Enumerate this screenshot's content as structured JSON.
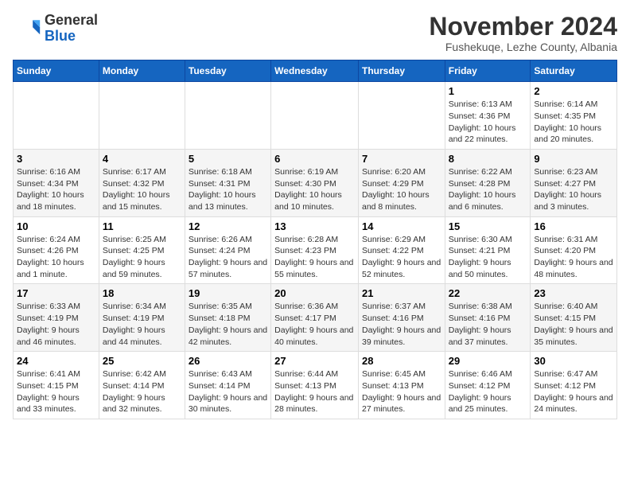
{
  "logo": {
    "general": "General",
    "blue": "Blue"
  },
  "title": "November 2024",
  "subtitle": "Fushekuqe, Lezhe County, Albania",
  "days_of_week": [
    "Sunday",
    "Monday",
    "Tuesday",
    "Wednesday",
    "Thursday",
    "Friday",
    "Saturday"
  ],
  "weeks": [
    [
      {
        "day": "",
        "info": ""
      },
      {
        "day": "",
        "info": ""
      },
      {
        "day": "",
        "info": ""
      },
      {
        "day": "",
        "info": ""
      },
      {
        "day": "",
        "info": ""
      },
      {
        "day": "1",
        "info": "Sunrise: 6:13 AM\nSunset: 4:36 PM\nDaylight: 10 hours and 22 minutes."
      },
      {
        "day": "2",
        "info": "Sunrise: 6:14 AM\nSunset: 4:35 PM\nDaylight: 10 hours and 20 minutes."
      }
    ],
    [
      {
        "day": "3",
        "info": "Sunrise: 6:16 AM\nSunset: 4:34 PM\nDaylight: 10 hours and 18 minutes."
      },
      {
        "day": "4",
        "info": "Sunrise: 6:17 AM\nSunset: 4:32 PM\nDaylight: 10 hours and 15 minutes."
      },
      {
        "day": "5",
        "info": "Sunrise: 6:18 AM\nSunset: 4:31 PM\nDaylight: 10 hours and 13 minutes."
      },
      {
        "day": "6",
        "info": "Sunrise: 6:19 AM\nSunset: 4:30 PM\nDaylight: 10 hours and 10 minutes."
      },
      {
        "day": "7",
        "info": "Sunrise: 6:20 AM\nSunset: 4:29 PM\nDaylight: 10 hours and 8 minutes."
      },
      {
        "day": "8",
        "info": "Sunrise: 6:22 AM\nSunset: 4:28 PM\nDaylight: 10 hours and 6 minutes."
      },
      {
        "day": "9",
        "info": "Sunrise: 6:23 AM\nSunset: 4:27 PM\nDaylight: 10 hours and 3 minutes."
      }
    ],
    [
      {
        "day": "10",
        "info": "Sunrise: 6:24 AM\nSunset: 4:26 PM\nDaylight: 10 hours and 1 minute."
      },
      {
        "day": "11",
        "info": "Sunrise: 6:25 AM\nSunset: 4:25 PM\nDaylight: 9 hours and 59 minutes."
      },
      {
        "day": "12",
        "info": "Sunrise: 6:26 AM\nSunset: 4:24 PM\nDaylight: 9 hours and 57 minutes."
      },
      {
        "day": "13",
        "info": "Sunrise: 6:28 AM\nSunset: 4:23 PM\nDaylight: 9 hours and 55 minutes."
      },
      {
        "day": "14",
        "info": "Sunrise: 6:29 AM\nSunset: 4:22 PM\nDaylight: 9 hours and 52 minutes."
      },
      {
        "day": "15",
        "info": "Sunrise: 6:30 AM\nSunset: 4:21 PM\nDaylight: 9 hours and 50 minutes."
      },
      {
        "day": "16",
        "info": "Sunrise: 6:31 AM\nSunset: 4:20 PM\nDaylight: 9 hours and 48 minutes."
      }
    ],
    [
      {
        "day": "17",
        "info": "Sunrise: 6:33 AM\nSunset: 4:19 PM\nDaylight: 9 hours and 46 minutes."
      },
      {
        "day": "18",
        "info": "Sunrise: 6:34 AM\nSunset: 4:19 PM\nDaylight: 9 hours and 44 minutes."
      },
      {
        "day": "19",
        "info": "Sunrise: 6:35 AM\nSunset: 4:18 PM\nDaylight: 9 hours and 42 minutes."
      },
      {
        "day": "20",
        "info": "Sunrise: 6:36 AM\nSunset: 4:17 PM\nDaylight: 9 hours and 40 minutes."
      },
      {
        "day": "21",
        "info": "Sunrise: 6:37 AM\nSunset: 4:16 PM\nDaylight: 9 hours and 39 minutes."
      },
      {
        "day": "22",
        "info": "Sunrise: 6:38 AM\nSunset: 4:16 PM\nDaylight: 9 hours and 37 minutes."
      },
      {
        "day": "23",
        "info": "Sunrise: 6:40 AM\nSunset: 4:15 PM\nDaylight: 9 hours and 35 minutes."
      }
    ],
    [
      {
        "day": "24",
        "info": "Sunrise: 6:41 AM\nSunset: 4:15 PM\nDaylight: 9 hours and 33 minutes."
      },
      {
        "day": "25",
        "info": "Sunrise: 6:42 AM\nSunset: 4:14 PM\nDaylight: 9 hours and 32 minutes."
      },
      {
        "day": "26",
        "info": "Sunrise: 6:43 AM\nSunset: 4:14 PM\nDaylight: 9 hours and 30 minutes."
      },
      {
        "day": "27",
        "info": "Sunrise: 6:44 AM\nSunset: 4:13 PM\nDaylight: 9 hours and 28 minutes."
      },
      {
        "day": "28",
        "info": "Sunrise: 6:45 AM\nSunset: 4:13 PM\nDaylight: 9 hours and 27 minutes."
      },
      {
        "day": "29",
        "info": "Sunrise: 6:46 AM\nSunset: 4:12 PM\nDaylight: 9 hours and 25 minutes."
      },
      {
        "day": "30",
        "info": "Sunrise: 6:47 AM\nSunset: 4:12 PM\nDaylight: 9 hours and 24 minutes."
      }
    ]
  ]
}
